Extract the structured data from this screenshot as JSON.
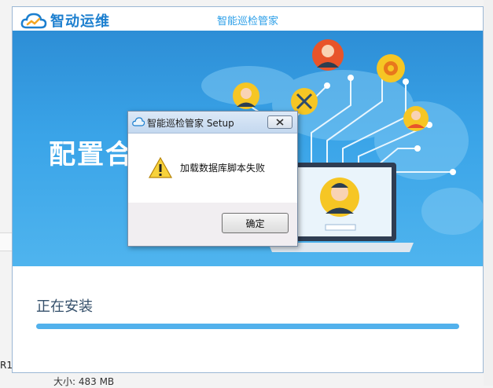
{
  "background": {
    "left_fragment_text": "R1.",
    "size_label": "大小: 483 MB"
  },
  "installer": {
    "brand_name": "智动运维",
    "window_title": "智能巡检管家",
    "banner_title": "配置合",
    "status_text": "正在安装",
    "progress": 1.0,
    "accent_color": "#52b1ec"
  },
  "dialog": {
    "title": "智能巡检管家 Setup",
    "message": "加载数据库脚本失败",
    "ok_label": "确定",
    "icon": "warning-icon",
    "close_icon": "close-icon"
  },
  "illustration": {
    "login_field_text": "•••••••"
  }
}
